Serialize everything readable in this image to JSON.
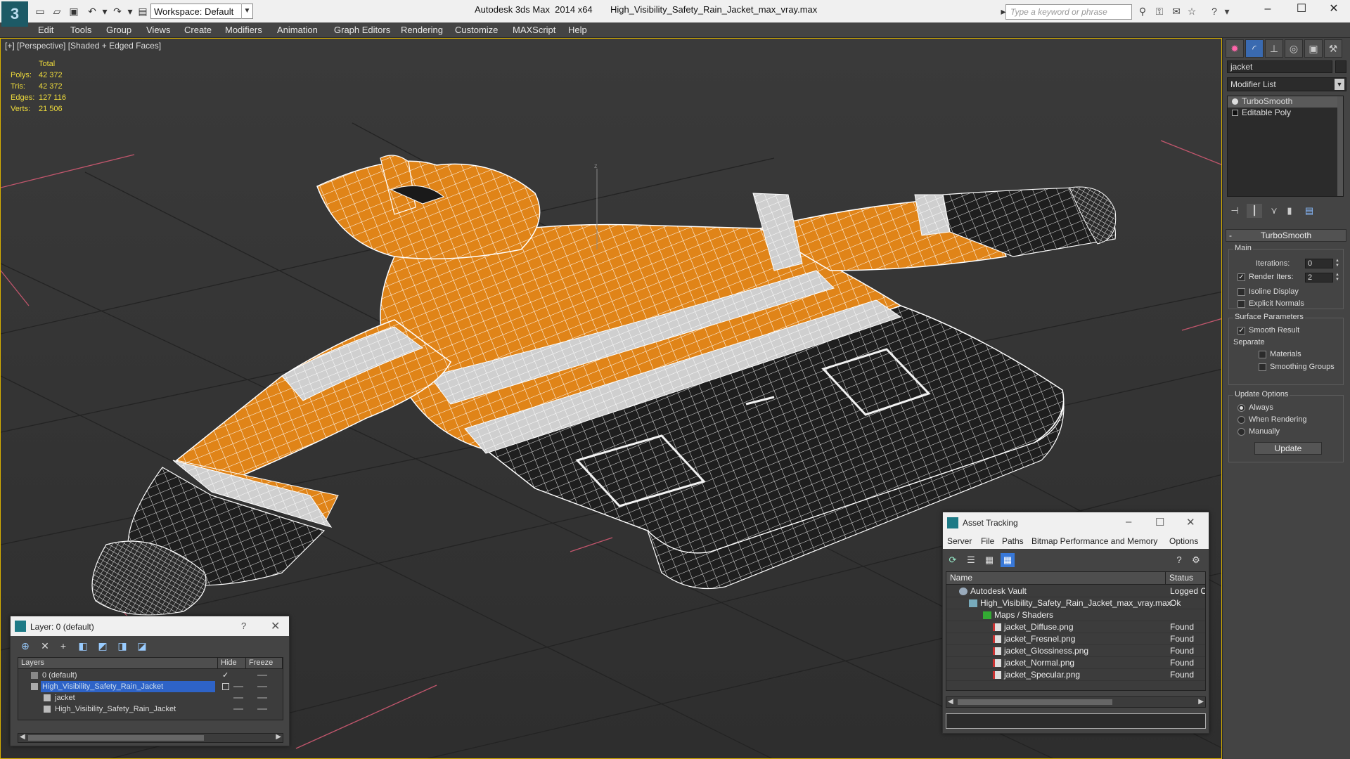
{
  "titlebar": {
    "workspace_label": "Workspace: Default",
    "title": "Autodesk 3ds Max  2014 x64       High_Visibility_Safety_Rain_Jacket_max_vray.max",
    "search_placeholder": "Type a keyword or phrase"
  },
  "menu": [
    "Edit",
    "Tools",
    "Group",
    "Views",
    "Create",
    "Modifiers",
    "Animation",
    "Graph Editors",
    "Rendering",
    "Customize",
    "MAXScript",
    "Help"
  ],
  "viewport": {
    "label": "[+] [Perspective] [Shaded + Edged Faces]",
    "stats": {
      "header": "Total",
      "rows": [
        {
          "k": "Polys:",
          "v": "42 372"
        },
        {
          "k": "Tris:",
          "v": "42 372"
        },
        {
          "k": "Edges:",
          "v": "127 116"
        },
        {
          "k": "Verts:",
          "v": "21 506"
        }
      ]
    },
    "colors": {
      "jacket": "#e08418",
      "reflective": "#d0d0d0",
      "dark": "#202020",
      "grid": "#222222",
      "border": "#d9b100"
    }
  },
  "command_panel": {
    "object_name": "jacket",
    "modifier_list": "Modifier List",
    "stack": [
      "TurboSmooth",
      "Editable Poly"
    ],
    "rollout_title": "TurboSmooth",
    "main_group": "Main",
    "iterations_label": "Iterations:",
    "iterations_value": "0",
    "render_iters_label": "Render Iters:",
    "render_iters_value": "2",
    "render_iters_checked": true,
    "isoline_label": "Isoline Display",
    "explicit_normals_label": "Explicit Normals",
    "surface_group": "Surface Parameters",
    "smooth_result_label": "Smooth Result",
    "separate_label": "Separate",
    "materials_label": "Materials",
    "smoothing_groups_label": "Smoothing Groups",
    "update_group": "Update Options",
    "always_label": "Always",
    "when_rendering_label": "When Rendering",
    "manually_label": "Manually",
    "update_button": "Update"
  },
  "layer_window": {
    "title": "Layer: 0 (default)",
    "help": "?",
    "columns": [
      "Layers",
      "Hide",
      "Freeze"
    ],
    "rows": [
      {
        "name": "0 (default)",
        "selected": false,
        "indent": 0
      },
      {
        "name": "High_Visibility_Safety_Rain_Jacket",
        "selected": true,
        "indent": 0
      },
      {
        "name": "jacket",
        "selected": false,
        "indent": 1
      },
      {
        "name": "High_Visibility_Safety_Rain_Jacket",
        "selected": false,
        "indent": 1
      }
    ]
  },
  "asset_window": {
    "title": "Asset Tracking",
    "menu": [
      "Server",
      "File",
      "Paths",
      "Bitmap Performance and Memory",
      "Options"
    ],
    "columns": [
      "Name",
      "Status"
    ],
    "rows": [
      {
        "name": "Autodesk Vault",
        "status": "Logged O",
        "indent": 0,
        "icon": "vault-icon"
      },
      {
        "name": "High_Visibility_Safety_Rain_Jacket_max_vray.max",
        "status": "Ok",
        "indent": 1,
        "icon": "max-file-icon"
      },
      {
        "name": "Maps / Shaders",
        "status": "",
        "indent": 2,
        "icon": "maps-icon"
      },
      {
        "name": "jacket_Diffuse.png",
        "status": "Found",
        "indent": 3,
        "icon": "png-icon"
      },
      {
        "name": "jacket_Fresnel.png",
        "status": "Found",
        "indent": 3,
        "icon": "png-icon"
      },
      {
        "name": "jacket_Glossiness.png",
        "status": "Found",
        "indent": 3,
        "icon": "png-icon"
      },
      {
        "name": "jacket_Normal.png",
        "status": "Found",
        "indent": 3,
        "icon": "png-icon"
      },
      {
        "name": "jacket_Specular.png",
        "status": "Found",
        "indent": 3,
        "icon": "png-icon"
      }
    ]
  }
}
